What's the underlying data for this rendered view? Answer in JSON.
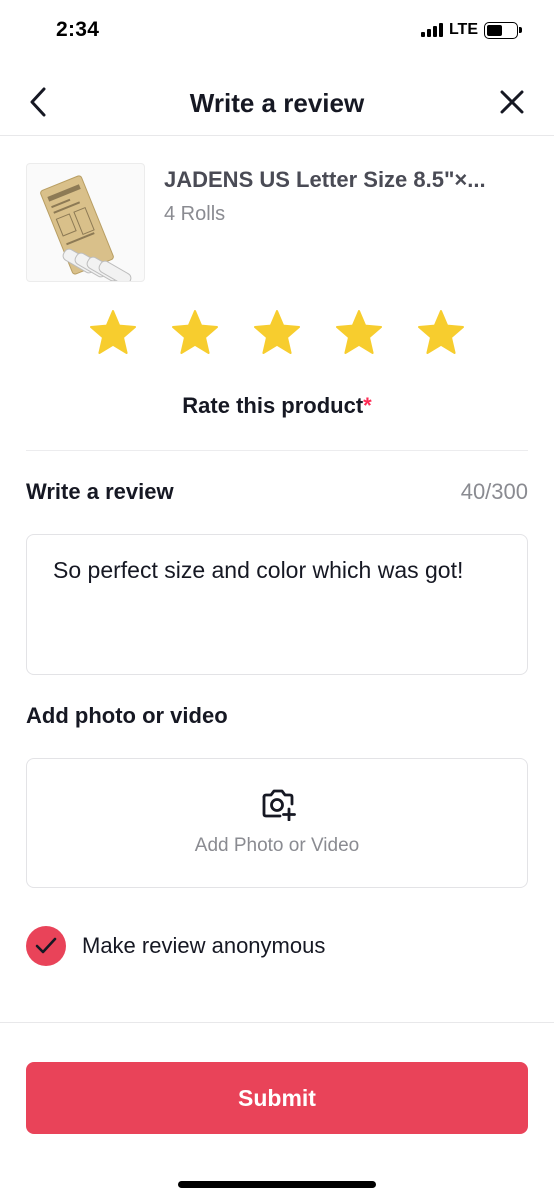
{
  "status_bar": {
    "time": "2:34",
    "network": "LTE",
    "battery_level": 0.55
  },
  "header": {
    "title": "Write a review",
    "back_icon": "chevron-left-icon",
    "close_icon": "close-icon"
  },
  "product": {
    "name": "JADENS US Letter Size 8.5\"×...",
    "variant": "4 Rolls"
  },
  "rating": {
    "value": 5,
    "max": 5,
    "star_color": "#f7cd2e",
    "label": "Rate this product",
    "required_mark": "*"
  },
  "review": {
    "label": "Write a review",
    "counter": "40/300",
    "text": "So perfect size and color which was got!"
  },
  "media": {
    "label": "Add photo or video",
    "button_label": "Add Photo or Video",
    "icon": "camera-plus-icon"
  },
  "anonymous": {
    "label": "Make review anonymous",
    "checked": true
  },
  "submit": {
    "label": "Submit"
  },
  "colors": {
    "accent": "#e94359",
    "required": "#fe2c55",
    "muted_text": "#8a8b91"
  }
}
